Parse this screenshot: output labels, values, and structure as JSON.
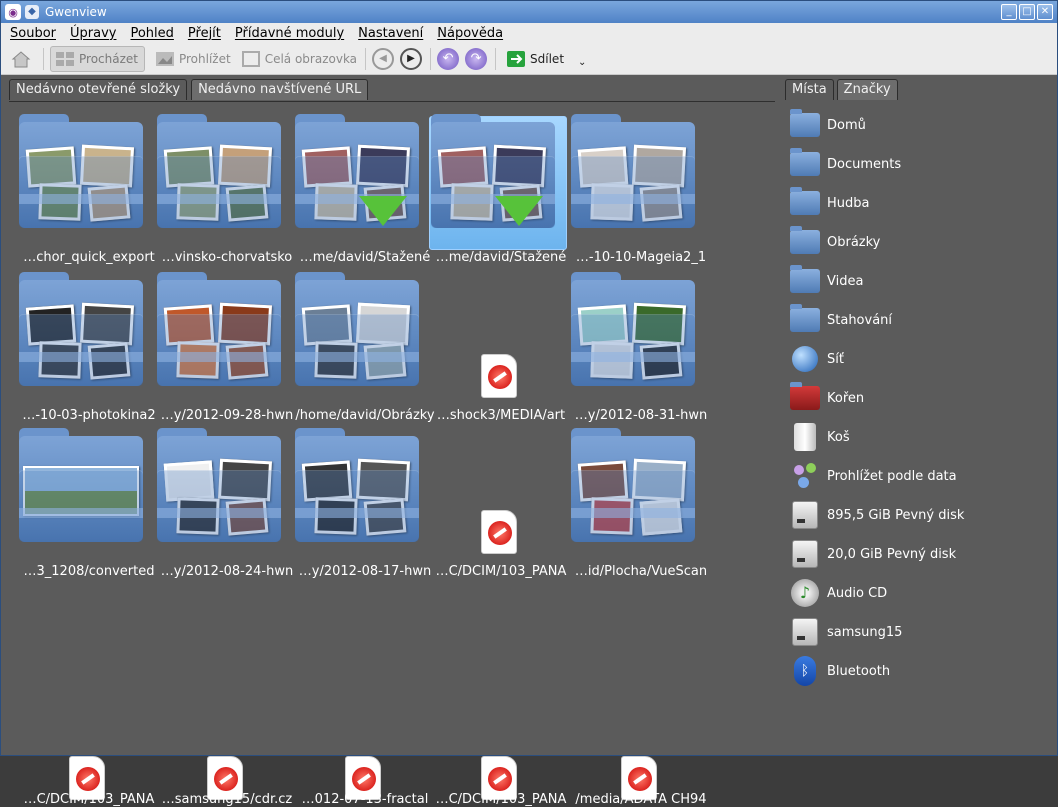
{
  "window": {
    "title": "Gwenview"
  },
  "menu": [
    "Soubor",
    "Úpravy",
    "Pohled",
    "Přejít",
    "Přídavné moduly",
    "Nastavení",
    "Nápověda"
  ],
  "toolbar": {
    "browse": "Procházet",
    "view": "Prohlížet",
    "fullscreen": "Celá obrazovka",
    "share": "Sdílet"
  },
  "tabs_left": [
    "Nedávno otevřené složky",
    "Nedávno navštívené URL"
  ],
  "tabs_right": [
    "Místa",
    "Značky"
  ],
  "items": [
    "…chor_quick_export",
    "…vinsko-chorvatsko",
    "…me/david/Stažené",
    "…me/david/Stažené",
    "…-10-10-Mageia2_1",
    "…-10-03-photokina2",
    "…y/2012-09-28-hwn",
    "/home/david/Obrázky",
    "…shock3/MEDIA/art",
    "…y/2012-08-31-hwn",
    "…3_1208/converted",
    "…y/2012-08-24-hwn",
    "…y/2012-08-17-hwn",
    "…C/DCIM/103_PANA",
    "…id/Plocha/VueScan",
    "…C/DCIM/103_PANA",
    "…samsung15/cdr.cz",
    "…012-07-13-fractal",
    "…C/DCIM/103_PANA",
    "/media/ADATA CH94"
  ],
  "places": [
    "Domů",
    "Documents",
    "Hudba",
    "Obrázky",
    "Videa",
    "Stahování",
    "Síť",
    "Kořen",
    "Koš",
    "Prohlížet podle data",
    "895,5 GiB Pevný disk",
    "20,0 GiB Pevný disk",
    "Audio CD",
    "samsung15",
    "Bluetooth"
  ],
  "colors": {
    "accent": "#4f82c6",
    "selection": "#8cc6f7",
    "bg": "#5b5b5b"
  }
}
